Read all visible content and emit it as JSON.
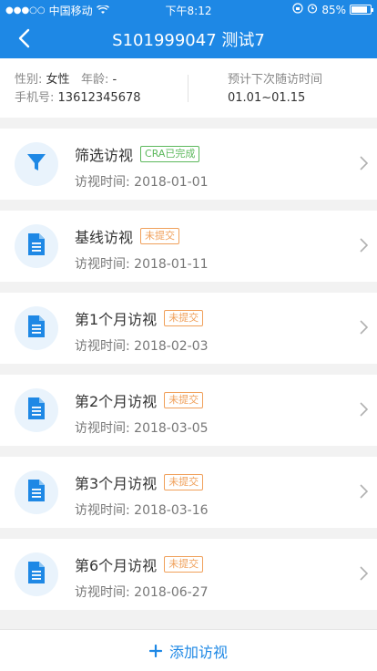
{
  "status_bar": {
    "carrier": "中国移动",
    "time": "下午8:12",
    "battery": "85%",
    "battery_level": 0.85
  },
  "nav": {
    "title": "S101999047 测试7",
    "back_icon": "chevron-left-icon"
  },
  "patient": {
    "gender_label": "性别:",
    "gender": "女性",
    "age_label": "年龄:",
    "age": "-",
    "phone_label": "手机号:",
    "phone": "13612345678",
    "next_visit_label": "预计下次随访时间",
    "next_visit": "01.01~01.15"
  },
  "visits": [
    {
      "title": "筛选访视",
      "badge": "CRA已完成",
      "time_label": "访视时间:",
      "time": "2018-01-01",
      "icon": "filter-icon"
    },
    {
      "title": "基线访视",
      "badge": "未提交",
      "time_label": "访视时间:",
      "time": "2018-01-11",
      "icon": "document-icon"
    },
    {
      "title": "第1个月访视",
      "badge": "未提交",
      "time_label": "访视时间:",
      "time": "2018-02-03",
      "icon": "document-icon"
    },
    {
      "title": "第2个月访视",
      "badge": "未提交",
      "time_label": "访视时间:",
      "time": "2018-03-05",
      "icon": "document-icon"
    },
    {
      "title": "第3个月访视",
      "badge": "未提交",
      "time_label": "访视时间:",
      "time": "2018-03-16",
      "icon": "document-icon"
    },
    {
      "title": "第6个月访视",
      "badge": "未提交",
      "time_label": "访视时间:",
      "time": "2018-06-27",
      "icon": "document-icon"
    }
  ],
  "footer": {
    "add_label": "添加访视"
  },
  "colors": {
    "primary": "#1e88e5",
    "done": "#5cb85c",
    "pending": "#f0a05a"
  }
}
